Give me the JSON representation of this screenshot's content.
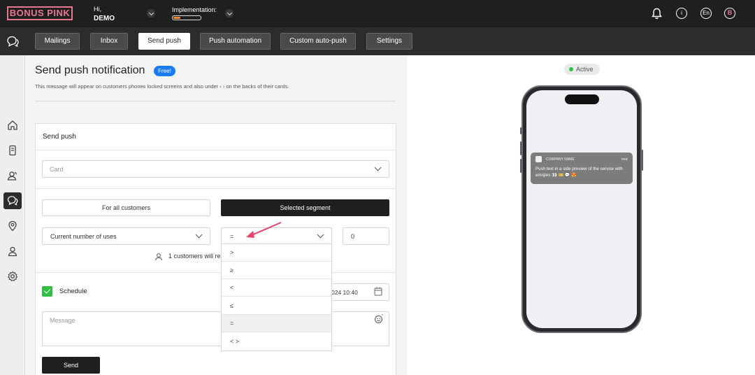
{
  "topbar": {
    "logo": "BONUS PINK",
    "greeting": "Hi,",
    "user": "DEMO",
    "implementation_label": "Implementation:",
    "implementation_progress": 0.25,
    "info_icon": "i",
    "language": "En",
    "avatar_letter": "B"
  },
  "nav": {
    "tabs": [
      {
        "label": "Mailings"
      },
      {
        "label": "Inbox"
      },
      {
        "label": "Send push"
      },
      {
        "label": "Push automation"
      },
      {
        "label": "Custom auto-push"
      },
      {
        "label": "Settings"
      }
    ],
    "active_tab": "Send push"
  },
  "sidebar": {
    "icons": [
      "home-icon",
      "card-icon",
      "customers-icon",
      "chat-icon",
      "location-icon",
      "user-icon",
      "gear-icon"
    ],
    "active": "chat-icon"
  },
  "main": {
    "title": "Send push notification",
    "badge": "Free!",
    "subtitle": "This message will appear on customers phones locked screens and also under ‹ › on the backs of their cards.",
    "card_title": "Send push",
    "card_placeholder": "Card",
    "segment_all": "For all customers",
    "segment_selected": "Selected segment",
    "condition_field": "Current number of uses",
    "operator_value": "=",
    "number_value": "0",
    "customers_count": "1 customers will rec",
    "schedule_label": "Schedule",
    "schedule_checked": true,
    "schedule_date": "024 10:40",
    "message_placeholder": "Message",
    "send_label": "Send"
  },
  "dropdown": {
    "options": [
      ">",
      "≥",
      "<",
      "≤",
      "=",
      "< >"
    ],
    "highlighted": "="
  },
  "preview": {
    "status": "Active",
    "notification": {
      "company": "COMPANY NAME",
      "time": "now",
      "text": "Push text in a side preview of the service with emojies 👀 🎫 💬 😍"
    }
  },
  "colors": {
    "brand_pink": "#e8788e",
    "badge_blue": "#1a7cf5",
    "success_green": "#2fc043",
    "dark": "#1f1f1f"
  }
}
